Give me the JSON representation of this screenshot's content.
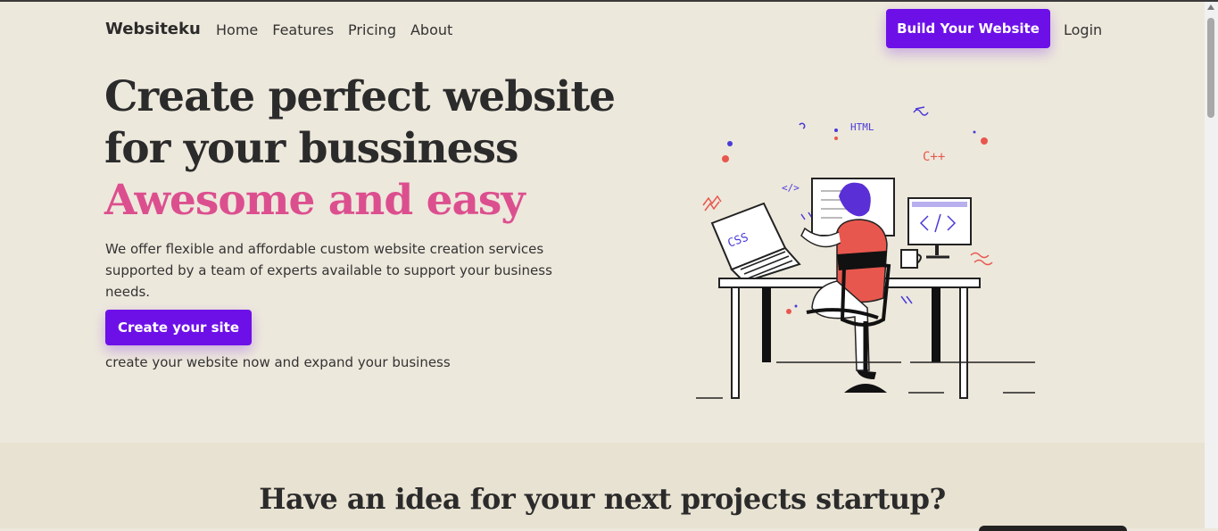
{
  "nav": {
    "brand": "Websiteku",
    "links": [
      "Home",
      "Features",
      "Pricing",
      "About"
    ],
    "build_button": "Build Your Website",
    "login": "Login"
  },
  "hero": {
    "title_line1": "Create perfect website",
    "title_line2": "for your bussiness",
    "title_accent": "Awesome and easy",
    "description": "We offer flexible and affordable custom website creation services supported by a team of experts available to support your business needs.",
    "cta_label": "Create your site",
    "cta_note": "create your website now and expand your business"
  },
  "illustration": {
    "labels": {
      "html": "HTML",
      "cpp": "C++",
      "css": "CSS",
      "code": "</>"
    },
    "icon": "developer-at-desk-illustration"
  },
  "section2": {
    "title": "Have an idea for your next projects startup?"
  },
  "colors": {
    "accent": "#6d10e8",
    "pink": "#dc4f8f",
    "background": "#ede8dc",
    "section_background": "#e8e2d2",
    "sweater": "#e8574e"
  }
}
